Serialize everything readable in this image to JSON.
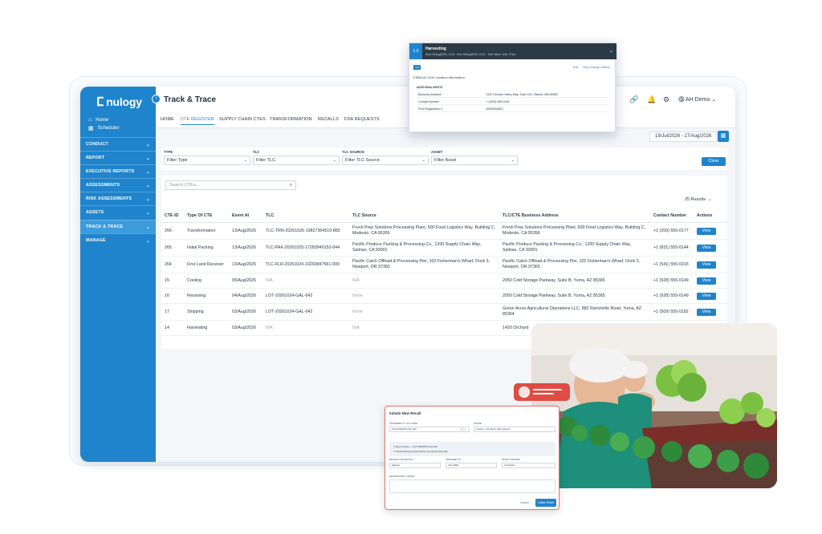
{
  "app": {
    "brand": "nulogy",
    "page_title": "Track & Trace",
    "user_label": "AH Demo",
    "accent_color": "#1f84cc",
    "sidebar_color": "#1f84cc"
  },
  "sidebar": {
    "links": [
      {
        "label": "Home",
        "icon": "home-icon"
      },
      {
        "label": "Scheduler",
        "icon": "calendar-icon"
      }
    ],
    "sections": [
      {
        "label": "CONDUCT",
        "active": false
      },
      {
        "label": "REPORT",
        "active": false
      },
      {
        "label": "EXECUTIVE REPORTS",
        "active": false
      },
      {
        "label": "ASSESSMENTS",
        "active": false
      },
      {
        "label": "RISK ASSESSMENTS",
        "active": false
      },
      {
        "label": "ASSETS",
        "active": false
      },
      {
        "label": "TRACK & TRACE",
        "active": true
      },
      {
        "label": "MANAGE",
        "active": false
      }
    ]
  },
  "tabs": [
    {
      "label": "HOME",
      "active": false
    },
    {
      "label": "CTE REGISTER",
      "active": true
    },
    {
      "label": "SUPPLY CHAIN CTES",
      "active": false
    },
    {
      "label": "TRANSFORMATION",
      "active": false
    },
    {
      "label": "RECALLS",
      "active": false
    },
    {
      "label": "FDA REQUESTS",
      "active": false
    }
  ],
  "date_range": "19/Jul/2026 - 17/Aug/2026",
  "filters": {
    "type": {
      "label": "TYPE",
      "placeholder": "Filter Type"
    },
    "tlc": {
      "label": "TLC",
      "placeholder": "Filter TLC"
    },
    "tlc_source": {
      "label": "TLC SOURCE",
      "placeholder": "Filter TLC Source"
    },
    "asset": {
      "label": "ASSET",
      "placeholder": "Filter Asset"
    },
    "clear_label": "Clear"
  },
  "search": {
    "placeholder": "Search CTEs..."
  },
  "results_label": "25 Results",
  "table": {
    "columns": [
      "CTE ID",
      "Type Of CTE",
      "Event At",
      "TLC",
      "TLC Source",
      "TLC/CTE Business Address",
      "Contact Number",
      "Actions"
    ],
    "action_label": "View",
    "rows": [
      {
        "id": "266",
        "type": "Transformation",
        "event": "13/Aug/2026",
        "tlc": "TLC-TRN-20261026-19827364510-882",
        "source": "Fresh Prep Solutions Processing Plant, 500 Food Logistics Way, Building C, Modesto, CA 95356",
        "address": "Fresh Prep Solutions Processing Plant, 500 Food Logistics Way, Building C, Modesto, CA 95356",
        "phone": "+1 (209) 555-0177",
        "muted_tlc": false,
        "muted_source": false
      },
      {
        "id": "265",
        "type": "Initial Packing",
        "event": "13/Aug/2026",
        "tlc": "TLC-PAK-20261025-17283940152-044",
        "source": "Pacific Produce Packing & Processing Co., 1200 Supply Chain Way, Salinas, CA 93901",
        "address": "Pacific Produce Packing & Processing Co., 1200 Supply Chain Way, Salinas, CA 93901",
        "phone": "+1 (831) 555-0144",
        "muted_tlc": false,
        "muted_source": false
      },
      {
        "id": "264",
        "type": "First Land Receiver",
        "event": "13/Aug/2026",
        "tlc": "TLC-FLR-20261024-10293847561-009",
        "source": "Pacific Catch Offload & Processing Pier, 102 Fisherman's Wharf, Dock 3, Newport, OR 97365",
        "address": "Pacific Catch Offload & Processing Pier, 102 Fisherman's Wharf, Dock 3, Newport, OR 97365",
        "phone": "+1 (541) 555-0193",
        "muted_tlc": false,
        "muted_source": false
      },
      {
        "id": "15",
        "type": "Cooling",
        "event": "05/Aug/2026",
        "tlc": "N/A",
        "source": "N/A",
        "address": "2050 Cold Storage Parkway, Suite B, Yuma, AZ 85365",
        "phone": "+1 (928) 555-0149",
        "muted_tlc": true,
        "muted_source": true
      },
      {
        "id": "16",
        "type": "Receiving",
        "event": "04/Aug/2026",
        "tlc": "LOT-20261024-GAL-042",
        "source": "None",
        "address": "2050 Cold Storage Parkway, Suite B, Yuma, AZ 85365",
        "phone": "+1 (928) 555-0149",
        "muted_tlc": false,
        "muted_source": true
      },
      {
        "id": "17",
        "type": "Shipping",
        "event": "03/Aug/2026",
        "tlc": "LOT-20261024-GAL-042",
        "source": "None",
        "address": "Green Acres Agricultural Operations LLC, 882 Ranchette Road, Yuma, AZ 85364",
        "phone": "+1 (509) 555-0182",
        "muted_tlc": false,
        "muted_source": true
      },
      {
        "id": "14",
        "type": "Harvesting",
        "event": "03/Aug/2026",
        "tlc": "N/A",
        "source": "N/A",
        "address": "1420 Orchard",
        "phone": "",
        "muted_tlc": true,
        "muted_source": true
      }
    ]
  },
  "harvest_popup": {
    "step": "1.0",
    "title": "Harvesting",
    "subtitle": "Start: 30/Aug/2026, 14:16 · End: 03/Aug/2026, 14:16 · Time Taken: 1min, 0?sec",
    "badge": "1.0",
    "edit": "Edit",
    "history": "View Change History",
    "fsma": "FSMA §1.1310 Location Information",
    "additional_inputs": "ADDITIONAL INPUTS",
    "rows": [
      {
        "k": "Business Address",
        "v": "1420 Orchard Valley Way, Suite 100, Yakima, WA 98908"
      },
      {
        "k": "Contact Number",
        "v": "+1 (509) 555-0182"
      },
      {
        "k": "FDA Registration #",
        "v": "18290054821"
      }
    ]
  },
  "recall_popup": {
    "title": "Initiate New Recall",
    "tlc_label": "TRACEABILITY LOT CODE",
    "tlc_value": "LOT-20261024-GAL-042",
    "scope_label": "SCOPE",
    "scope_value": "1-down + full supply chain descent",
    "info_line1": "1 lot(s) in scope — LOT-20261024-GAL-042",
    "info_line2": "1 critical tracking event(s) will be covered by this recall.",
    "reason_label": "REASON FOR RECALL",
    "reason_value": "Allergen",
    "owner_label": "ASSIGNED TO",
    "owner_value": "Jane Miller",
    "notify_label": "NOTIFY PARTIES",
    "notify_value": "2 Selected",
    "desc_label": "DESCRIPTION / NOTES",
    "cancel": "Cancel",
    "submit": "Initiate Recall"
  }
}
